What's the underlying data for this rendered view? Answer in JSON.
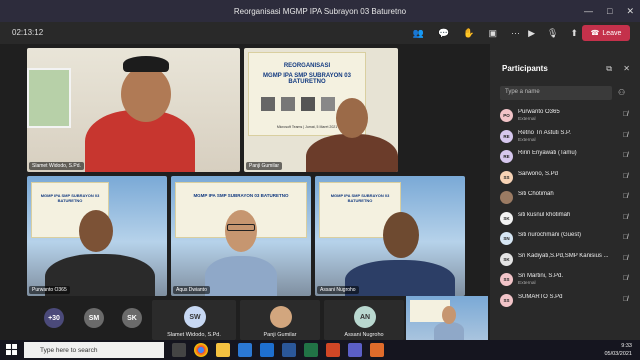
{
  "window": {
    "title": "Reorganisasi MGMP IPA Subrayon 03 Baturetno",
    "controls": [
      "—",
      "□",
      "✕"
    ]
  },
  "toolbar": {
    "timer": "02:13:12",
    "leave_label": "Leave",
    "icons": [
      "people-icon",
      "chat-icon",
      "hand-icon",
      "rooms-icon",
      "more-icon",
      "camera-icon",
      "mic-icon",
      "share-icon"
    ]
  },
  "banner": {
    "line1": "REORGANISASI",
    "line2": "MGMP IPA SMP SUBRAYON 03 BATURETNO",
    "footer": "Microsoft Teams | Jumat, 5 Maret 2021"
  },
  "video_tiles": [
    {
      "name": "Slamet Widodo, S.Pd."
    },
    {
      "name": "Panji Gumilar"
    },
    {
      "name": "Purwanto O365"
    },
    {
      "name": "Aqus Dwianto"
    },
    {
      "name": "Assani Nugroho"
    }
  ],
  "bottom_row": {
    "overflow_count": "+30",
    "small_avatars": [
      {
        "initials": "SM",
        "color": "#6b6b6b"
      },
      {
        "initials": "SK",
        "color": "#6b6b6b"
      }
    ],
    "tiles": [
      {
        "initials": "SW",
        "name": "Slamet Widodo, S.Pd.",
        "color": "#c7d8f3"
      },
      {
        "initials": "",
        "name": "Panji Gumilar",
        "color": "#d2a67e"
      },
      {
        "initials": "AN",
        "name": "Assani Nugroho",
        "color": "#b9d8d0"
      }
    ]
  },
  "participants_panel": {
    "title": "Participants",
    "search_placeholder": "Type a name",
    "people": [
      {
        "initials": "PO",
        "name": "Purwanto O365",
        "sub": "External",
        "color": "#f2c4c8"
      },
      {
        "initials": "RE",
        "name": "Retno Tri Astuti S.P.",
        "sub": "External",
        "color": "#d6c7ee"
      },
      {
        "initials": "RE",
        "name": "Ririn Eriyawati (Tamu)",
        "sub": "",
        "color": "#d6c7ee"
      },
      {
        "initials": "SS",
        "name": "Sarwono, S.Pd",
        "sub": "",
        "color": "#f7d3b5"
      },
      {
        "initials": "",
        "name": "Siti Chotimah",
        "sub": "",
        "color": "#9b7b63"
      },
      {
        "initials": "SK",
        "name": "siti kusnul khotimah",
        "sub": "",
        "color": "#f2f2f2"
      },
      {
        "initials": "SN",
        "name": "Siti nurochmani (Guest)",
        "sub": "",
        "color": "#d6e6f4"
      },
      {
        "initials": "SK",
        "name": "Sri Kadiyati,S.Pd,SMP Kanisius ...",
        "sub": "",
        "color": "#e4e4e4"
      },
      {
        "initials": "SS",
        "name": "Sri Martini, S.Pd.",
        "sub": "External",
        "color": "#f2c4c8"
      },
      {
        "initials": "SS",
        "name": "SUMARTO S.Pd",
        "sub": "",
        "color": "#f2c4c8"
      }
    ]
  },
  "taskbar": {
    "search_text": "Type here to search",
    "time": "9:33",
    "date": "05/03/2021"
  }
}
